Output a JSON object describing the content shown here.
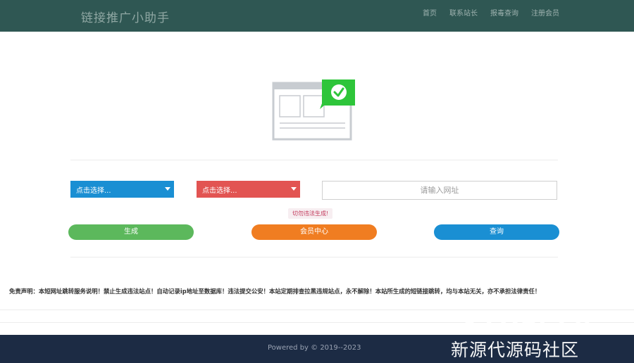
{
  "header": {
    "brand": "链接推广小助手",
    "nav": [
      "首页",
      "联系站长",
      "报毒查询",
      "注册会员"
    ]
  },
  "form": {
    "select_primary": "点击选择...",
    "select_secondary": "点击选择...",
    "url_placeholder": "请输入网址",
    "warning": "切勿违法生成!",
    "buttons": {
      "generate": "生成",
      "member_center": "会员中心",
      "query": "查询"
    }
  },
  "disclaimer": "免责声明：本短网址跳转服务说明！禁止生成违法站点！自动记录ip地址至数据库！违法提交公安！本站定期排查拉黑违规站点，永不解除！本站所生成的短链接跳转，均与本站无关，亦不承担法律责任！",
  "footer": {
    "text": "Powered by © 2019--2023"
  },
  "watermark": {
    "line1": "XYDai.cn",
    "line2": "新源代源码社区"
  },
  "icons": {
    "hero": "webpage-check-icon",
    "select_caret": "caret-down-icon"
  },
  "colors": {
    "navbar": "#2f5753",
    "select_primary": "#1a8fd3",
    "select_secondary": "#e25452",
    "generate": "#5cb85c",
    "member_center": "#f07d21",
    "query": "#1a8fd3",
    "check_badge": "#2ec53a",
    "footer": "#1c2b44"
  }
}
